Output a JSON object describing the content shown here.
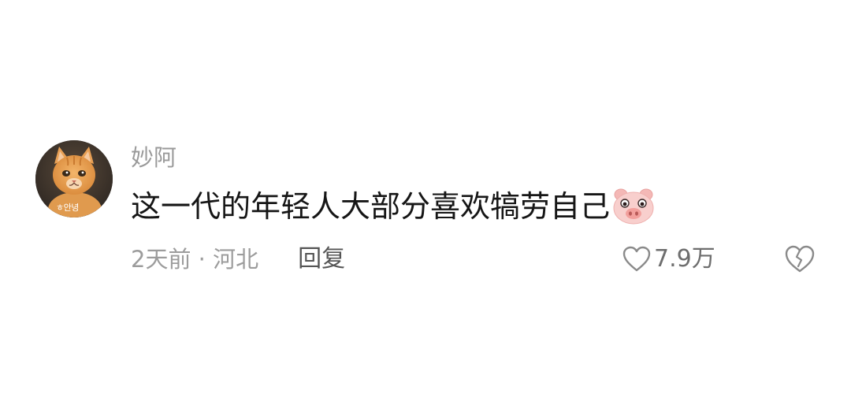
{
  "comment": {
    "username": "妙阿",
    "content": "这一代的年轻人大部分喜欢犒劳自己",
    "emoji": "pig-face-emoji",
    "meta": "2天前 · 河北",
    "reply_label": "回复",
    "like_count": "7.9万"
  },
  "avatar": {
    "caption": "ㅎ안녕"
  },
  "colors": {
    "username": "#9a9a9a",
    "content": "#161616",
    "meta": "#9c9c9c",
    "reply": "#555555",
    "icon": "#8a8a8a",
    "pig_pink": "#f6c6c4"
  }
}
